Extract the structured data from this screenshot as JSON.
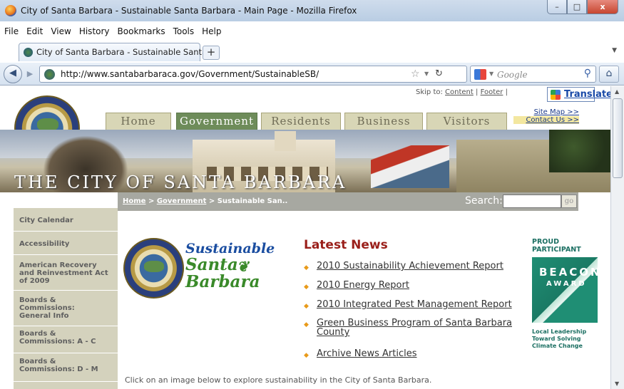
{
  "window": {
    "title": "City of Santa Barbara - Sustainable Santa Barbara - Main Page - Mozilla Firefox",
    "min_glyph": "–",
    "max_glyph": "□",
    "close_glyph": "x"
  },
  "menubar": {
    "items": [
      "File",
      "Edit",
      "View",
      "History",
      "Bookmarks",
      "Tools",
      "Help"
    ]
  },
  "tab": {
    "label": "City of Santa Barbara - Sustainable Santa...",
    "new_tab": "+"
  },
  "navbar": {
    "url": "http://www.santabarbaraca.gov/Government/SustainableSB/",
    "search_placeholder": "Google"
  },
  "page": {
    "skip": {
      "prefix": "Skip to:",
      "content": "Content",
      "sep": "|",
      "footer": "Footer",
      "sep2": "|"
    },
    "translate": "Translate",
    "nav_tabs": [
      "Home",
      "Government",
      "Residents",
      "Business",
      "Visitors"
    ],
    "active_tab": "Government",
    "sitemap": "Site Map >>",
    "contact": "Contact Us >>",
    "banner_text": "THE CITY OF SANTA BARBARA",
    "breadcrumb": {
      "home": "Home",
      "sep1": ">",
      "gov": "Government",
      "sep2": ">",
      "current": "Sustainable San.."
    },
    "search_label": "Search:",
    "search_go": "go",
    "left_nav": [
      "City Calendar",
      "Accessibility",
      "American Recovery and Reinvestment Act of 2009",
      "Boards & Commissions: General Info",
      "Boards & Commissions: A - C",
      "Boards & Commissions: D - M"
    ],
    "logo": {
      "line1": "Sustainable",
      "line2": "Santa",
      "line3": "Barbara"
    },
    "news_title": "Latest News",
    "news": [
      "2010 Sustainability Achievement Report",
      "2010 Energy Report",
      "2010 Integrated Pest Management Report",
      "Green Business Program of Santa Barbara County",
      "Archive News Articles"
    ],
    "beacon": {
      "proud": "PROUD PARTICIPANT",
      "title": "BEACON",
      "subtitle": "AWARD",
      "tagline": "Local Leadership Toward Solving Climate Change"
    },
    "explore": "Click on an image below to explore sustainability in the City of Santa Barbara."
  }
}
